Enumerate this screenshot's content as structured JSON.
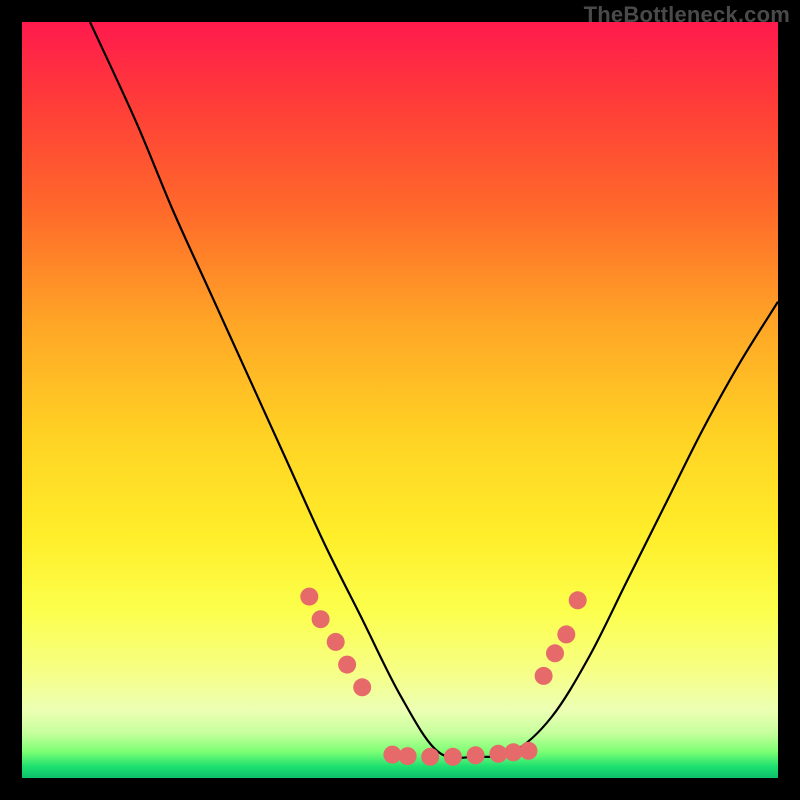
{
  "watermark": "TheBottleneck.com",
  "colors": {
    "frame": "#000000",
    "curve_stroke": "#000000",
    "dot_fill": "#e66a6a",
    "gradient_top": "#ff1a4d",
    "gradient_bottom": "#0cc06a"
  },
  "chart_data": {
    "type": "line",
    "title": "",
    "xlabel": "",
    "ylabel": "",
    "xlim": [
      0,
      100
    ],
    "ylim": [
      0,
      100
    ],
    "legend": false,
    "grid": false,
    "note": "Axes unlabeled in source image; x and y treated as 0–100 percent of plot area. y = 0 at bottom (green band). Curve descends steeply from upper-left, bottoms out near x≈55, then rises toward upper-right. Pink dots are placed along the curve near the valley region.",
    "series": [
      {
        "name": "bottleneck-curve",
        "x": [
          9,
          15,
          20,
          25,
          30,
          35,
          40,
          45,
          50,
          55,
          60,
          65,
          70,
          75,
          80,
          85,
          90,
          95,
          100
        ],
        "y": [
          100,
          87,
          75,
          64,
          53,
          42,
          31,
          21,
          11,
          3.5,
          2.8,
          3.5,
          8,
          16,
          26,
          36,
          46,
          55,
          63
        ]
      }
    ],
    "dots": [
      {
        "x": 38.0,
        "y": 24.0
      },
      {
        "x": 39.5,
        "y": 21.0
      },
      {
        "x": 41.5,
        "y": 18.0
      },
      {
        "x": 43.0,
        "y": 15.0
      },
      {
        "x": 45.0,
        "y": 12.0
      },
      {
        "x": 49.0,
        "y": 3.1
      },
      {
        "x": 51.0,
        "y": 2.9
      },
      {
        "x": 54.0,
        "y": 2.8
      },
      {
        "x": 57.0,
        "y": 2.8
      },
      {
        "x": 60.0,
        "y": 3.0
      },
      {
        "x": 63.0,
        "y": 3.2
      },
      {
        "x": 65.0,
        "y": 3.4
      },
      {
        "x": 67.0,
        "y": 3.6
      },
      {
        "x": 69.0,
        "y": 13.5
      },
      {
        "x": 70.5,
        "y": 16.5
      },
      {
        "x": 72.0,
        "y": 19.0
      },
      {
        "x": 73.5,
        "y": 23.5
      }
    ]
  }
}
